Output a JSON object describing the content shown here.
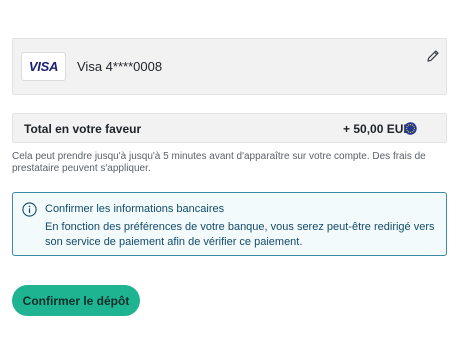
{
  "card": {
    "brand": "VISA",
    "label": "Visa 4****0008"
  },
  "total": {
    "label": "Total en votre faveur",
    "amount": "+ 50,00 EUR"
  },
  "note": "Cela peut prendre jusqu'à jusqu'à 5 minutes avant d'apparaître sur votre compte. Des frais de prestataire peuvent s'appliquer.",
  "info": {
    "title": "Confirmer les informations bancaires",
    "body": "En fonction des préférences de votre banque, vous serez peut-être redirigé vers son service de paiement afin de vérifier ce paiement."
  },
  "actions": {
    "confirm_label": "Confirmer le dépôt"
  },
  "colors": {
    "accent": "#1fb491",
    "info_border": "#3d8aa3",
    "info_text": "#124b6b",
    "visa_blue": "#1a1f71",
    "eu_blue": "#1f3a93",
    "eu_star": "#f2c230"
  },
  "icons": {
    "edit": "pencil-icon",
    "currency": "eu-flag-icon",
    "info": "info-icon"
  }
}
